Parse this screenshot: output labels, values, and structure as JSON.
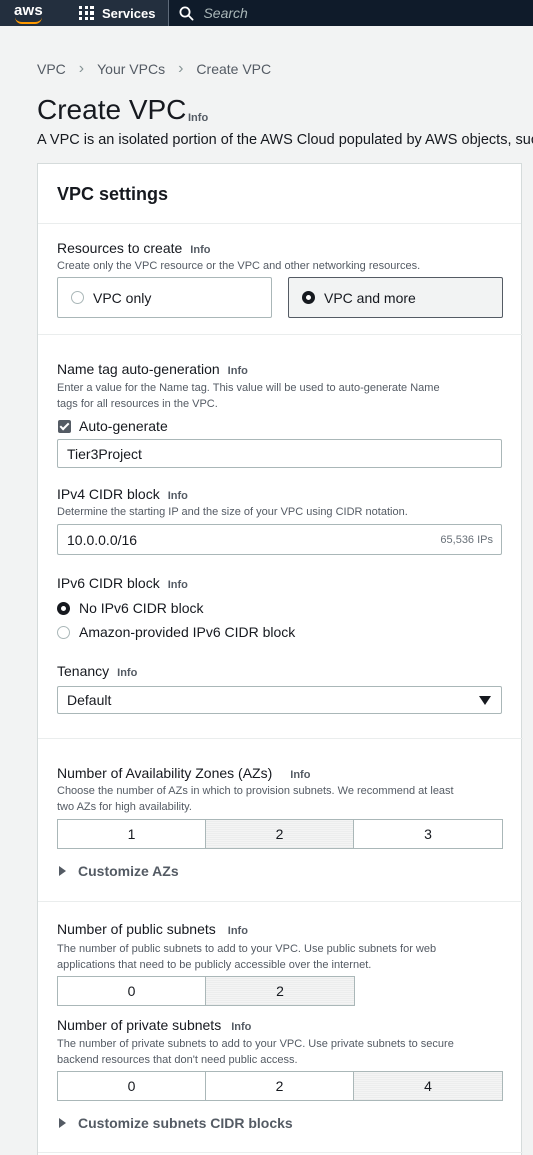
{
  "nav": {
    "logo": "aws",
    "services_label": "Services",
    "search_placeholder": "Search"
  },
  "breadcrumb": {
    "items": [
      "VPC",
      "Your VPCs",
      "Create VPC"
    ]
  },
  "page": {
    "title": "Create VPC",
    "title_info": "Info",
    "description": "A VPC is an isolated portion of the AWS Cloud populated by AWS objects, such"
  },
  "settings": {
    "title": "VPC settings",
    "resources": {
      "label": "Resources to create",
      "info": "Info",
      "description": "Create only the VPC resource or the VPC and other networking resources.",
      "options": [
        "VPC only",
        "VPC and more"
      ],
      "selected": "VPC and more"
    },
    "name_tag": {
      "label": "Name tag auto-generation",
      "info": "Info",
      "description_line1": "Enter a value for the Name tag. This value will be used to auto-generate Name",
      "description_line2": "tags for all resources in the VPC.",
      "checkbox_label": "Auto-generate",
      "checked": true,
      "value": "Tier3Project"
    },
    "ipv4": {
      "label": "IPv4 CIDR block",
      "info": "Info",
      "description": "Determine the starting IP and the size of your VPC using CIDR notation.",
      "value": "10.0.0.0/16",
      "hint": "65,536 IPs"
    },
    "ipv6": {
      "label": "IPv6 CIDR block",
      "info": "Info",
      "options": [
        "No IPv6 CIDR block",
        "Amazon-provided IPv6 CIDR block"
      ],
      "selected": "No IPv6 CIDR block"
    },
    "tenancy": {
      "label": "Tenancy",
      "info": "Info",
      "value": "Default"
    },
    "azs": {
      "label": "Number of Availability Zones (AZs)",
      "info": "Info",
      "description_line1": "Choose the number of AZs in which to provision subnets. We recommend at least",
      "description_line2": "two AZs for high availability.",
      "options": [
        "1",
        "2",
        "3"
      ],
      "selected": "2",
      "customize_label": "Customize AZs"
    },
    "public_subnets": {
      "label": "Number of public subnets",
      "info": "Info",
      "description_line1": "The number of public subnets to add to your VPC. Use public subnets for web",
      "description_line2": "applications that need to be publicly accessible over the internet.",
      "options": [
        "0",
        "2"
      ],
      "selected": "2"
    },
    "private_subnets": {
      "label": "Number of private subnets",
      "info": "Info",
      "description_line1": "The number of private subnets to add to your VPC. Use private subnets to secure",
      "description_line2": "backend resources that don't need public access.",
      "options": [
        "0",
        "2",
        "4"
      ],
      "selected": "4",
      "customize_label": "Customize subnets CIDR blocks"
    }
  },
  "colors": {
    "nav_bg": "#232f3e",
    "accent": "#ff9900",
    "page_bg": "#f2f3f3"
  }
}
